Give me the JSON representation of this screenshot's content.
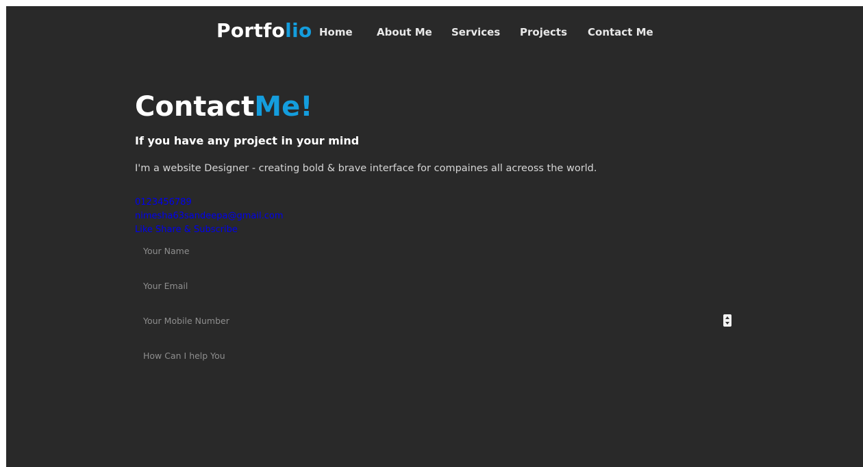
{
  "navbar": {
    "logo_main": "Portfo",
    "logo_accent": "lio",
    "items": [
      {
        "label": "Home"
      },
      {
        "label": "About Me"
      },
      {
        "label": "Services"
      },
      {
        "label": "Projects"
      },
      {
        "label": "Contact Me"
      }
    ]
  },
  "contact": {
    "heading_main": "Contact",
    "heading_accent": "Me!",
    "subheading": "If you have any project in your mind",
    "description": "I'm a website Designer - creating bold & brave interface for compaines all acreoss the world.",
    "phone": "0123456789",
    "email": "nimesha63sandeepa@gmail.com",
    "social": "Like Share & Subscribe"
  },
  "form": {
    "name_placeholder": "Your Name",
    "email_placeholder": "Your Email",
    "mobile_placeholder": "Your Mobile Number",
    "message_placeholder": "How Can I help You"
  },
  "colors": {
    "background": "#292929",
    "accent": "#149ddd",
    "link": "#0000ee"
  }
}
